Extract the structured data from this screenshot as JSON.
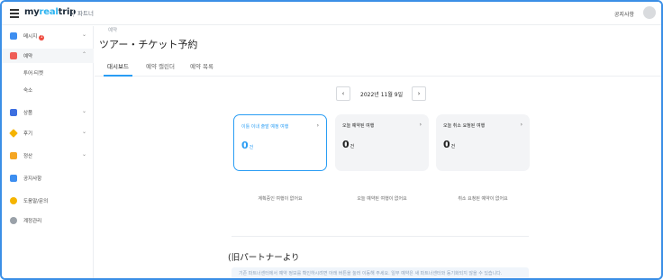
{
  "header": {
    "logo_prefix": "my",
    "logo_accent": "real",
    "logo_suffix": "trip",
    "partner_label": "파트너",
    "notice_link": "공지사항"
  },
  "sidebar": {
    "items": [
      {
        "label": "메시지",
        "icon": "message-icon",
        "color": "#3d8ef0",
        "badge": "1",
        "chevron": "⌄"
      },
      {
        "label": "예약",
        "icon": "calendar-icon",
        "color": "#ef5d56",
        "chevron": "⌃"
      },
      {
        "label": "상품",
        "icon": "grid-icon",
        "color": "#3d6fe0",
        "chevron": "⌄"
      },
      {
        "label": "후기",
        "icon": "star-icon",
        "color": "#f5b400",
        "chevron": "⌄"
      },
      {
        "label": "정산",
        "icon": "settlement-icon",
        "color": "#f5a623",
        "chevron": "⌄"
      },
      {
        "label": "공지사항",
        "icon": "megaphone-icon",
        "color": "#3d8ef0"
      },
      {
        "label": "도움말/문의",
        "icon": "help-icon",
        "color": "#f5b400"
      },
      {
        "label": "계정관리",
        "icon": "gear-icon",
        "color": "#9aa1a9"
      }
    ],
    "subitems": [
      "투어·티켓",
      "숙소"
    ]
  },
  "main": {
    "breadcrumb": "예약",
    "title": "ツアー・チケット予約",
    "tabs": [
      "대시보드",
      "예약 캘린더",
      "예약 목록"
    ],
    "date": {
      "prev": "‹",
      "label": "2022년 11월 9일",
      "next": "›"
    },
    "cards": [
      {
        "title": "이틀 이내 출발 예정 여행",
        "count": "0",
        "unit": "건",
        "arrow": "›"
      },
      {
        "title": "오늘 예약된 여행",
        "count": "0",
        "unit": "건",
        "arrow": "›"
      },
      {
        "title": "오늘 취소 요청된 여행",
        "count": "0",
        "unit": "건",
        "arrow": "›"
      }
    ],
    "empty_messages": [
      "계획중인 여행이 없어요",
      "오늘 예약된 여행이 없어요",
      "취소 요청된 예약이 없어요"
    ],
    "old_partner_title": "(旧パートナーより",
    "info_text": "기존 파트너센터에서 예약 정보를 확인하시려면 아래 버튼을 눌러 이동해 주세요. 일부 예약은 새 파트너센터와 동기화되지 않을 수 있습니다."
  },
  "colors": {
    "accent": "#2a9df4",
    "badge": "#ef4b3f",
    "frame": "#3b8fe6"
  }
}
